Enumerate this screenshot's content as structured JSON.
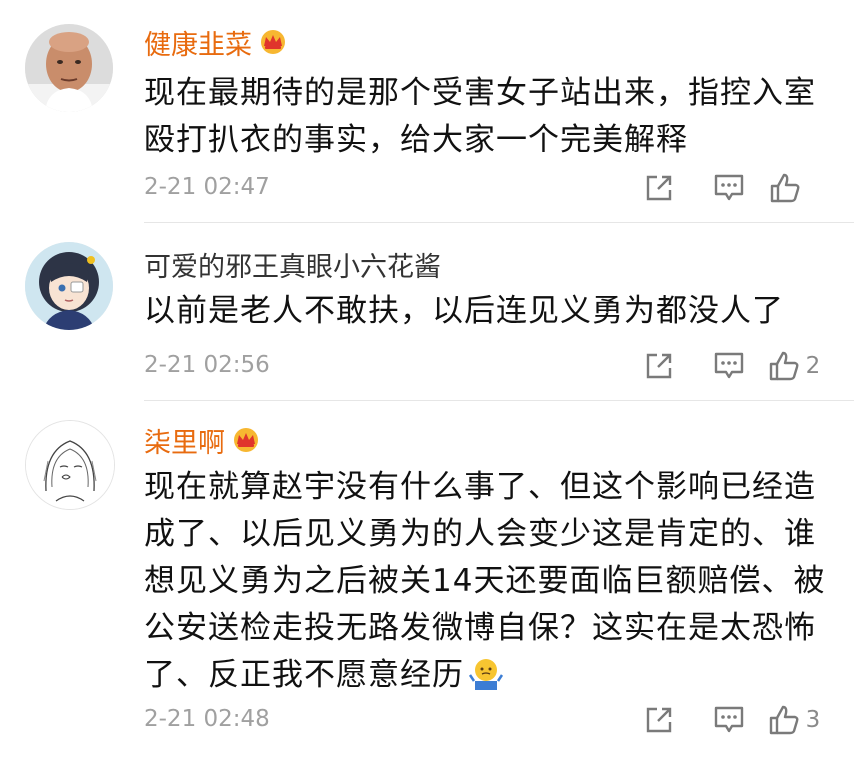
{
  "comments": [
    {
      "username": "健康韭菜",
      "vip": true,
      "text": "现在最期待的是那个受害女子站出来，指控入室殴打扒衣的事实，给大家一个完美解释",
      "timestamp": "2-21 02:47",
      "likes": "",
      "avatar_icon": "bald-man-avatar"
    },
    {
      "username": "可爱的邪王真眼小六花酱",
      "vip": false,
      "text": "以前是老人不敢扶，以后连见义勇为都没人了",
      "timestamp": "2-21 02:56",
      "likes": "2",
      "avatar_icon": "anime-girl-avatar"
    },
    {
      "username": "柒里啊",
      "vip": true,
      "text": "现在就算赵宇没有什么事了、但这个影响已经造成了、以后见义勇为的人会变少这是肯定的、谁想见义勇为之后被关14天还要面临巨额赔偿、被公安送检走投无路发微博自保？这实在是太恐怖了、反正我不愿意经历",
      "timestamp": "2-21 02:48",
      "likes": "3",
      "avatar_icon": "sketch-girl-avatar",
      "trailing_emoji": "shrug-emoji"
    }
  ],
  "colors": {
    "vip_name": "#e86b0f",
    "normal_name": "#333333",
    "body_text": "#111111",
    "meta": "#a0a0a0",
    "icon": "#7a7a7a",
    "divider": "#e6e6e6"
  },
  "icons": {
    "share": "share-icon",
    "reply": "comment-icon",
    "like": "thumbs-up-icon",
    "vip": "crown-icon"
  }
}
